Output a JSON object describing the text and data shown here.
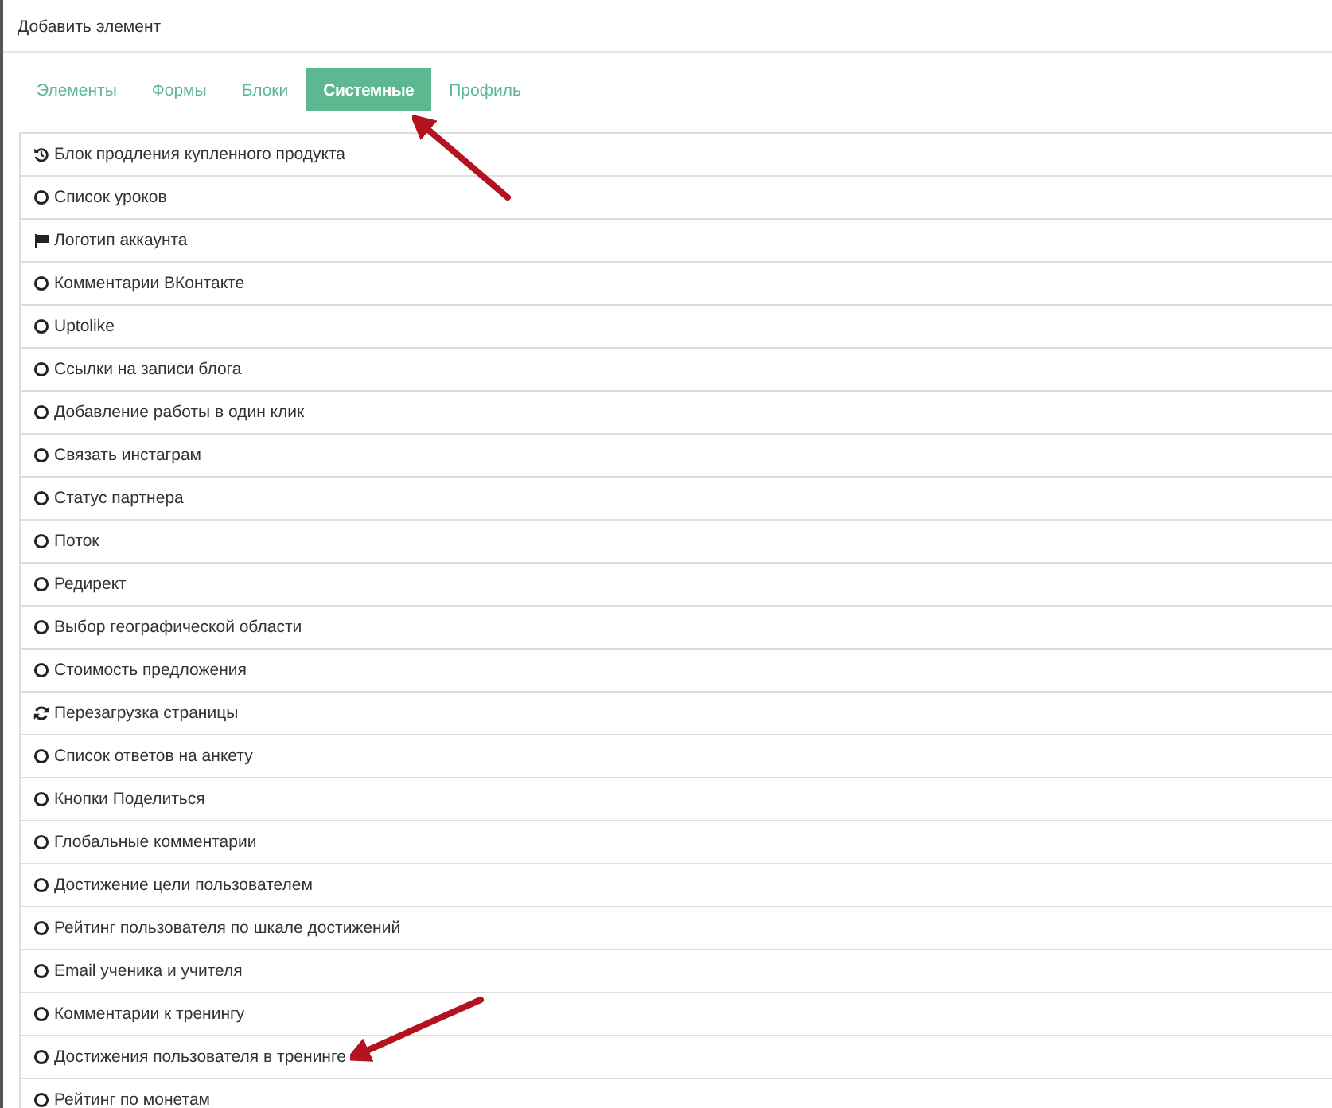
{
  "dialog": {
    "title": "Добавить элемент"
  },
  "tabs": [
    {
      "label": "Элементы",
      "selected": false,
      "pointer": false
    },
    {
      "label": "Формы",
      "selected": false,
      "pointer": false
    },
    {
      "label": "Блоки",
      "selected": false,
      "pointer": false
    },
    {
      "label": "Системные",
      "selected": true,
      "pointer": true
    },
    {
      "label": "Профиль",
      "selected": false,
      "pointer": false
    }
  ],
  "items": [
    {
      "label": "Блок продления купленного продукта",
      "kind": "history",
      "pointer": false
    },
    {
      "label": "Список уроков",
      "kind": "circle",
      "pointer": false
    },
    {
      "label": "Логотип аккаунта",
      "kind": "flag",
      "pointer": false
    },
    {
      "label": "Комментарии ВКонтакте",
      "kind": "circle",
      "pointer": false
    },
    {
      "label": "Uptolike",
      "kind": "circle",
      "pointer": false
    },
    {
      "label": "Ссылки на записи блога",
      "kind": "circle",
      "pointer": false
    },
    {
      "label": "Добавление работы в один клик",
      "kind": "circle",
      "pointer": false
    },
    {
      "label": "Связать инстаграм",
      "kind": "circle",
      "pointer": false
    },
    {
      "label": "Статус партнера",
      "kind": "circle",
      "pointer": false
    },
    {
      "label": "Поток",
      "kind": "circle",
      "pointer": false
    },
    {
      "label": "Редирект",
      "kind": "circle",
      "pointer": false
    },
    {
      "label": "Выбор географической области",
      "kind": "circle",
      "pointer": false
    },
    {
      "label": "Стоимость предложения",
      "kind": "circle",
      "pointer": false
    },
    {
      "label": "Перезагрузка страницы",
      "kind": "refresh",
      "pointer": false
    },
    {
      "label": "Список ответов на анкету",
      "kind": "circle",
      "pointer": false
    },
    {
      "label": "Кнопки Поделиться",
      "kind": "circle",
      "pointer": false
    },
    {
      "label": "Глобальные комментарии",
      "kind": "circle",
      "pointer": false
    },
    {
      "label": "Достижение цели пользователем",
      "kind": "circle",
      "pointer": false
    },
    {
      "label": "Рейтинг пользователя по шкале достижений",
      "kind": "circle",
      "pointer": false
    },
    {
      "label": "Email ученика и учителя",
      "kind": "circle",
      "pointer": false
    },
    {
      "label": "Комментарии к тренингу",
      "kind": "circle",
      "pointer": false
    },
    {
      "label": "Достижения пользователя в тренинге",
      "kind": "circle",
      "pointer": true
    },
    {
      "label": "Рейтинг по монетам",
      "kind": "circle",
      "pointer": false
    }
  ]
}
